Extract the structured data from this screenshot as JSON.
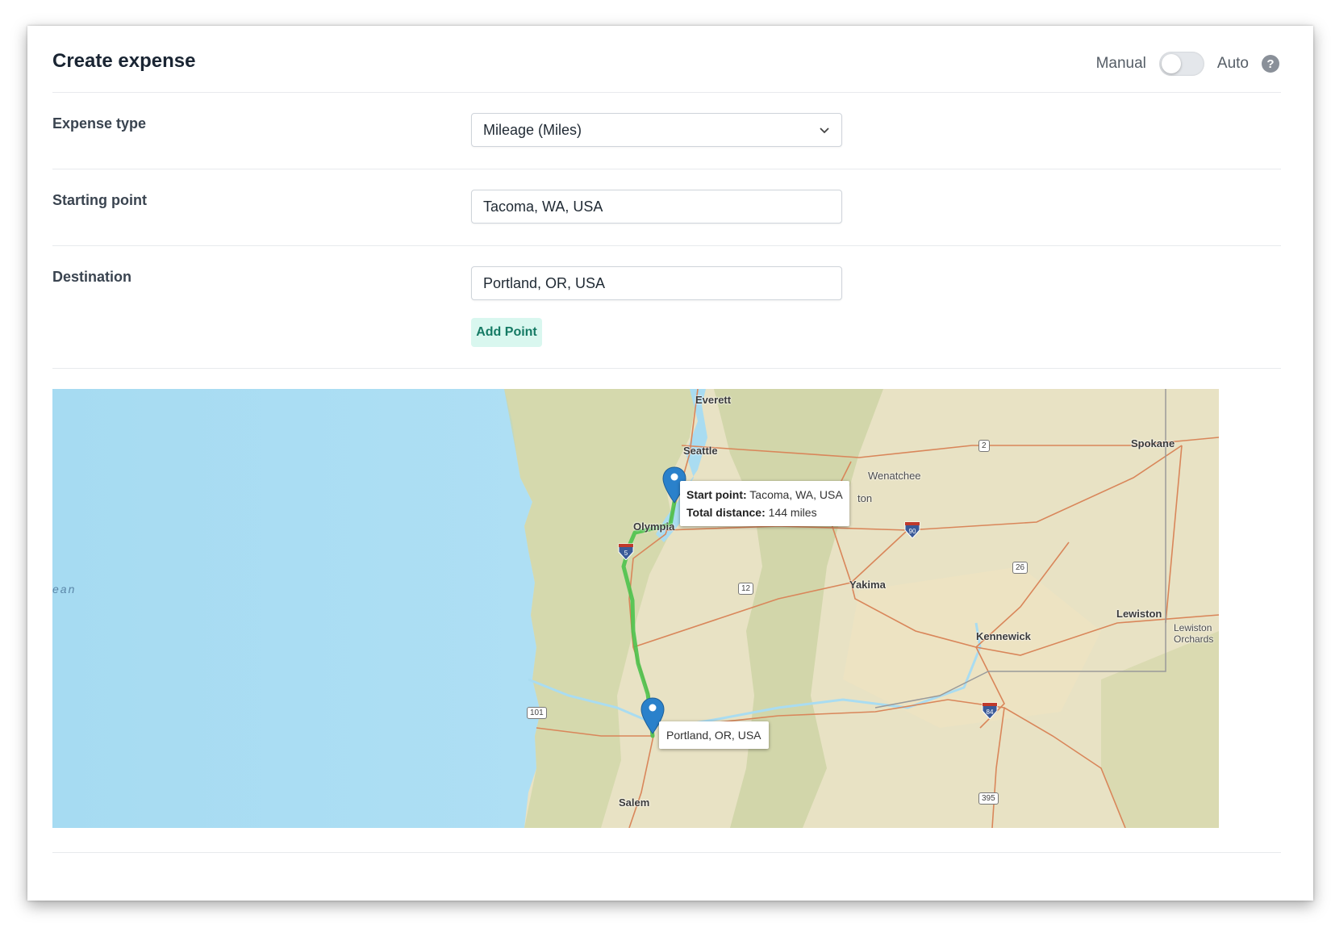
{
  "header": {
    "title": "Create expense",
    "mode_manual": "Manual",
    "mode_auto": "Auto",
    "mode_auto_enabled": false,
    "help_glyph": "?"
  },
  "form": {
    "expense_type": {
      "label": "Expense type",
      "value": "Mileage (Miles)"
    },
    "starting_point": {
      "label": "Starting point",
      "value": "Tacoma, WA, USA"
    },
    "destination": {
      "label": "Destination",
      "value": "Portland, OR, USA"
    },
    "add_point_label": "Add Point"
  },
  "map": {
    "ocean_label": "ean",
    "cities": {
      "everett": "Everett",
      "seattle": "Seattle",
      "wenatchee": "Wenatchee",
      "olympia": "Olympia",
      "yakima": "Yakima",
      "spokane": "Spokane",
      "lewiston": "Lewiston",
      "lewiston_orchards_1": "Lewiston",
      "lewiston_orchards_2": "Orchards",
      "kennewick": "Kennewick",
      "salem": "Salem",
      "ton_fragment": "ton"
    },
    "shields": {
      "us2": "2",
      "i90": "90",
      "us26": "26",
      "us12": "12",
      "i5": "5",
      "us101": "101",
      "i84": "84",
      "us395": "395"
    },
    "start_popup": {
      "start_label": "Start point:",
      "start_value": "Tacoma, WA, USA",
      "distance_label": "Total distance:",
      "distance_value": "144 miles"
    },
    "end_popup": {
      "value": "Portland, OR, USA"
    },
    "colors": {
      "ocean": "#a8dcf2",
      "land": "#e9e3c8",
      "route": "#4cc24c",
      "marker": "#2a81cb",
      "roads": "#d9865a"
    }
  }
}
